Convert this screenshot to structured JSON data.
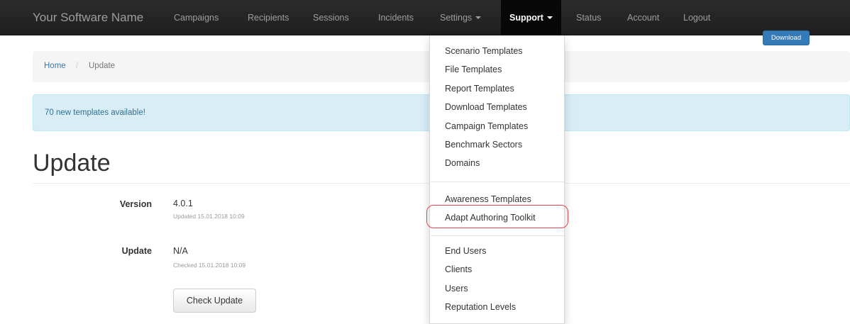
{
  "navbar": {
    "brand": "Your Software Name",
    "items": [
      "Campaigns",
      "Recipients",
      "Sessions",
      "Incidents",
      "Settings",
      "Support",
      "Status",
      "Account",
      "Logout"
    ]
  },
  "breadcrumb": {
    "home": "Home",
    "separator": "/",
    "current": "Update"
  },
  "alert": {
    "text": "70 new templates available!",
    "button": "Download"
  },
  "page": {
    "title": "Update"
  },
  "info": {
    "version_label": "Version",
    "version_value": "4.0.1",
    "version_sub": "Updated 15.01.2018 10:09",
    "update_label": "Update",
    "update_value": "N/A",
    "update_sub": "Checked 15.01.2018 10:09",
    "check_button": "Check Update"
  },
  "dropdown": {
    "group1": [
      "Scenario Templates",
      "File Templates",
      "Report Templates",
      "Download Templates",
      "Campaign Templates",
      "Benchmark Sectors",
      "Domains"
    ],
    "group2": [
      "Awareness Templates",
      "Adapt Authoring Toolkit"
    ],
    "group3": [
      "End Users",
      "Clients",
      "Users",
      "Reputation Levels"
    ]
  },
  "colors": {
    "navbar": "#222222",
    "link": "#337ab7",
    "alert_bg": "#d9edf7",
    "highlight": "#e0444e"
  }
}
